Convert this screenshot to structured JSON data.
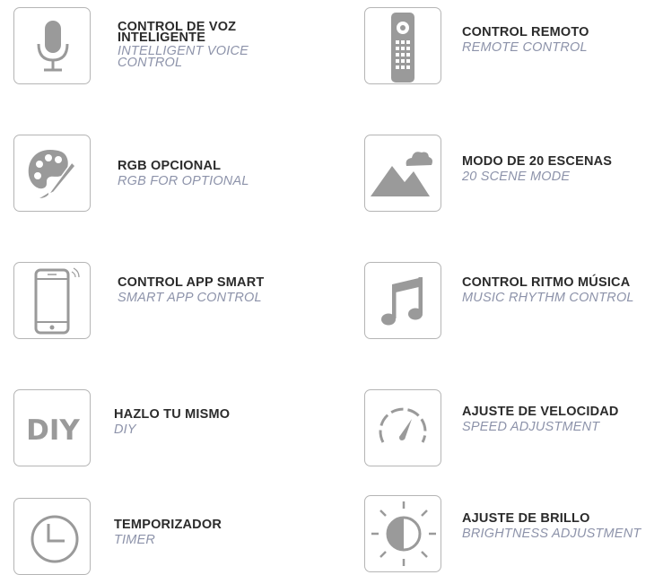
{
  "features": [
    {
      "title": "CONTROL DE VOZ INTELIGENTE",
      "subtitle": "INTELLIGENT VOICE CONTROL",
      "icon": "microphone-icon"
    },
    {
      "title": "CONTROL REMOTO",
      "subtitle": "REMOTE CONTROL",
      "icon": "remote-control-icon"
    },
    {
      "title": "RGB OPCIONAL",
      "subtitle": "RGB FOR OPTIONAL",
      "icon": "palette-icon"
    },
    {
      "title": "MODO DE 20 ESCENAS",
      "subtitle": "20 SCENE MODE",
      "icon": "landscape-icon"
    },
    {
      "title": "CONTROL APP SMART",
      "subtitle": "SMART APP CONTROL",
      "icon": "smartphone-icon"
    },
    {
      "title": "CONTROL RITMO MÚSICA",
      "subtitle": "MUSIC RHYTHM CONTROL",
      "icon": "music-note-icon"
    },
    {
      "title": "HAZLO TU MISMO",
      "subtitle": "DIY",
      "icon": "diy-icon",
      "icon_text": "DIY"
    },
    {
      "title": "AJUSTE DE VELOCIDAD",
      "subtitle": "SPEED ADJUSTMENT",
      "icon": "speedometer-icon"
    },
    {
      "title": "TEMPORIZADOR",
      "subtitle": "TIMER",
      "icon": "clock-icon"
    },
    {
      "title": "AJUSTE DE BRILLO",
      "subtitle": "BRIGHTNESS ADJUSTMENT",
      "icon": "brightness-icon"
    }
  ],
  "colors": {
    "title": "#2b2b2b",
    "subtitle": "#8d93aa",
    "icon": "#9a9a9a",
    "border": "#b5b5b5"
  }
}
